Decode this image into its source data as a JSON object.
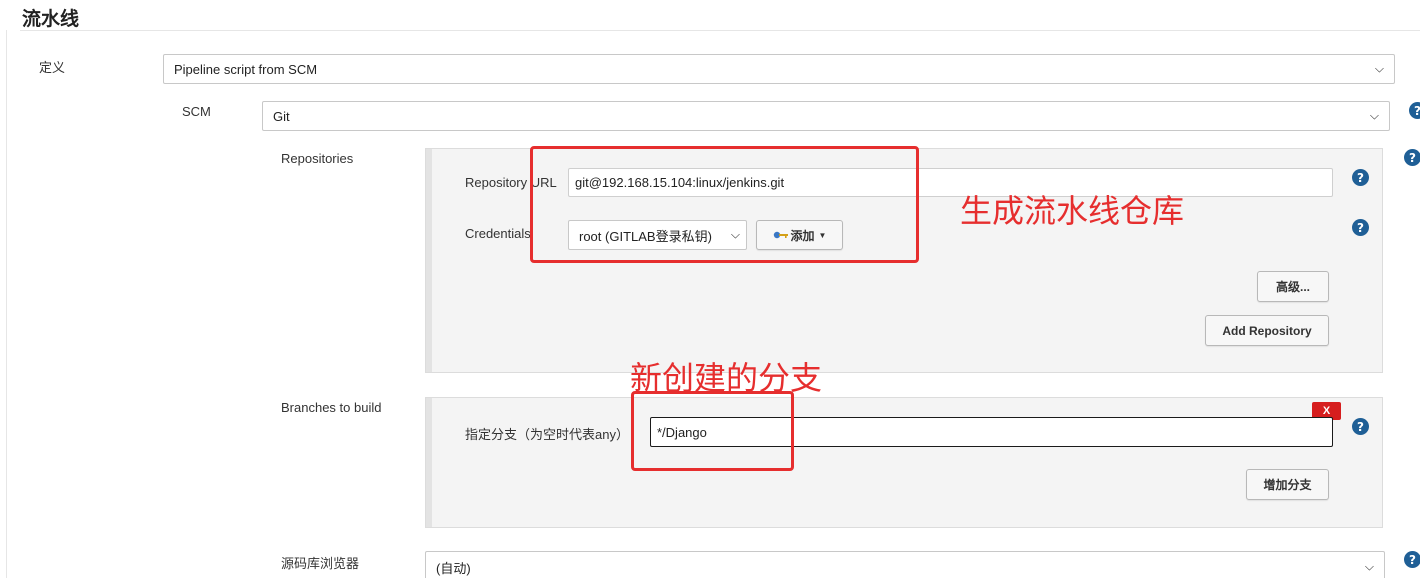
{
  "section": {
    "title": "流水线"
  },
  "definition": {
    "label": "定义",
    "value": "Pipeline script from SCM"
  },
  "scm": {
    "label": "SCM",
    "value": "Git"
  },
  "repositories": {
    "label": "Repositories",
    "url_label": "Repository URL",
    "url_value": "git@192.168.15.104:linux/jenkins.git",
    "credentials_label": "Credentials",
    "credentials_value": "root (GITLAB登录私钥)",
    "add_button_label": "添加",
    "advanced_button_label": "高级...",
    "add_repository_label": "Add Repository"
  },
  "branches": {
    "label": "Branches to build",
    "spec_label": "指定分支（为空时代表any）",
    "spec_value": "*/Django",
    "delete_label": "X",
    "add_branch_label": "增加分支"
  },
  "browser": {
    "label": "源码库浏览器",
    "value": "(自动)"
  },
  "annotations": {
    "repo_note": "生成流水线仓库",
    "branch_note": "新创建的分支",
    "color": "#e62e2e"
  },
  "icons": {
    "help": "?",
    "chevron": "⌵"
  }
}
